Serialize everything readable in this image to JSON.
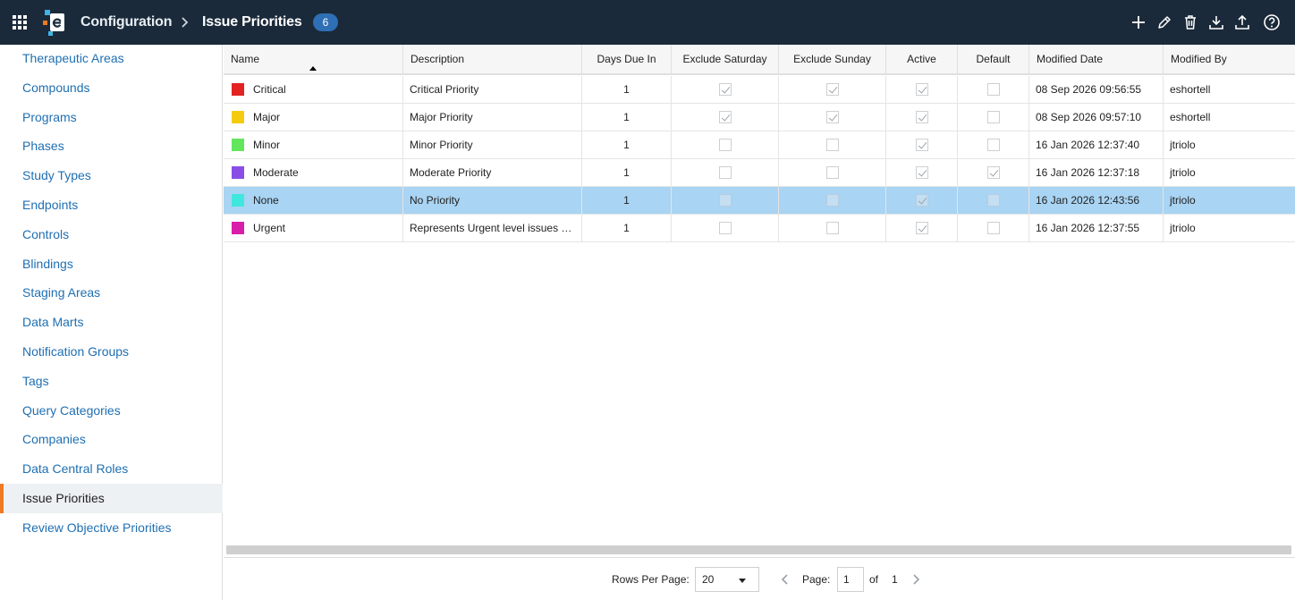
{
  "header": {
    "breadcrumb_root": "Configuration",
    "breadcrumb_current": "Issue Priorities",
    "count_badge": "6",
    "colors": {
      "bar": "#1b2a3a",
      "badge": "#2e6fb5"
    },
    "actions": [
      "plus-icon",
      "pencil-icon",
      "trash-icon",
      "download-icon",
      "upload-icon",
      "help-icon"
    ]
  },
  "sidebar": {
    "items": [
      {
        "label": "Therapeutic Areas",
        "active": false
      },
      {
        "label": "Compounds",
        "active": false
      },
      {
        "label": "Programs",
        "active": false
      },
      {
        "label": "Phases",
        "active": false
      },
      {
        "label": "Study Types",
        "active": false
      },
      {
        "label": "Endpoints",
        "active": false
      },
      {
        "label": "Controls",
        "active": false
      },
      {
        "label": "Blindings",
        "active": false
      },
      {
        "label": "Staging Areas",
        "active": false
      },
      {
        "label": "Data Marts",
        "active": false
      },
      {
        "label": "Notification Groups",
        "active": false
      },
      {
        "label": "Tags",
        "active": false
      },
      {
        "label": "Query Categories",
        "active": false
      },
      {
        "label": "Companies",
        "active": false
      },
      {
        "label": "Data Central Roles",
        "active": false
      },
      {
        "label": "Issue Priorities",
        "active": true
      },
      {
        "label": "Review Objective Priorities",
        "active": false
      }
    ],
    "accent_color": "#f07a22"
  },
  "table": {
    "columns": [
      "Name",
      "Description",
      "Days Due In",
      "Exclude Saturday",
      "Exclude Sunday",
      "Active",
      "Default",
      "Modified Date",
      "Modified By"
    ],
    "sort": {
      "column": "Name",
      "direction": "ascending"
    },
    "rows": [
      {
        "color": "#e32222",
        "name": "Critical",
        "description": "Critical Priority",
        "days": "1",
        "sat": true,
        "sun": true,
        "active": true,
        "default": false,
        "modified_date": "08 Sep 2026 09:56:55",
        "modified_by": "eshortell",
        "selected": false
      },
      {
        "color": "#f5cb0f",
        "name": "Major",
        "description": "Major Priority",
        "days": "1",
        "sat": true,
        "sun": true,
        "active": true,
        "default": false,
        "modified_date": "08 Sep 2026 09:57:10",
        "modified_by": "eshortell",
        "selected": false
      },
      {
        "color": "#63e65c",
        "name": "Minor",
        "description": "Minor Priority",
        "days": "1",
        "sat": false,
        "sun": false,
        "active": true,
        "default": false,
        "modified_date": "16 Jan 2026 12:37:40",
        "modified_by": "jtriolo",
        "selected": false
      },
      {
        "color": "#8a4ee6",
        "name": "Moderate",
        "description": "Moderate Priority",
        "days": "1",
        "sat": false,
        "sun": false,
        "active": true,
        "default": true,
        "modified_date": "16 Jan 2026 12:37:18",
        "modified_by": "jtriolo",
        "selected": false
      },
      {
        "color": "#3fe7dc",
        "name": "None",
        "description": "No Priority",
        "days": "1",
        "sat": false,
        "sun": false,
        "active": true,
        "default": false,
        "modified_date": "16 Jan 2026 12:43:56",
        "modified_by": "jtriolo",
        "selected": true
      },
      {
        "color": "#d81fa9",
        "name": "Urgent",
        "description": "Represents Urgent level issues and should be addressed quickly",
        "days": "1",
        "sat": false,
        "sun": false,
        "active": true,
        "default": false,
        "modified_date": "16 Jan 2026 12:37:55",
        "modified_by": "jtriolo",
        "selected": false
      }
    ],
    "selected_row_color": "#a9d4f3"
  },
  "pager": {
    "rows_per_page_label": "Rows Per Page:",
    "rows_per_page_value": "20",
    "page_label": "Page:",
    "page_value": "1",
    "of_label": "of",
    "total_pages": "1"
  }
}
